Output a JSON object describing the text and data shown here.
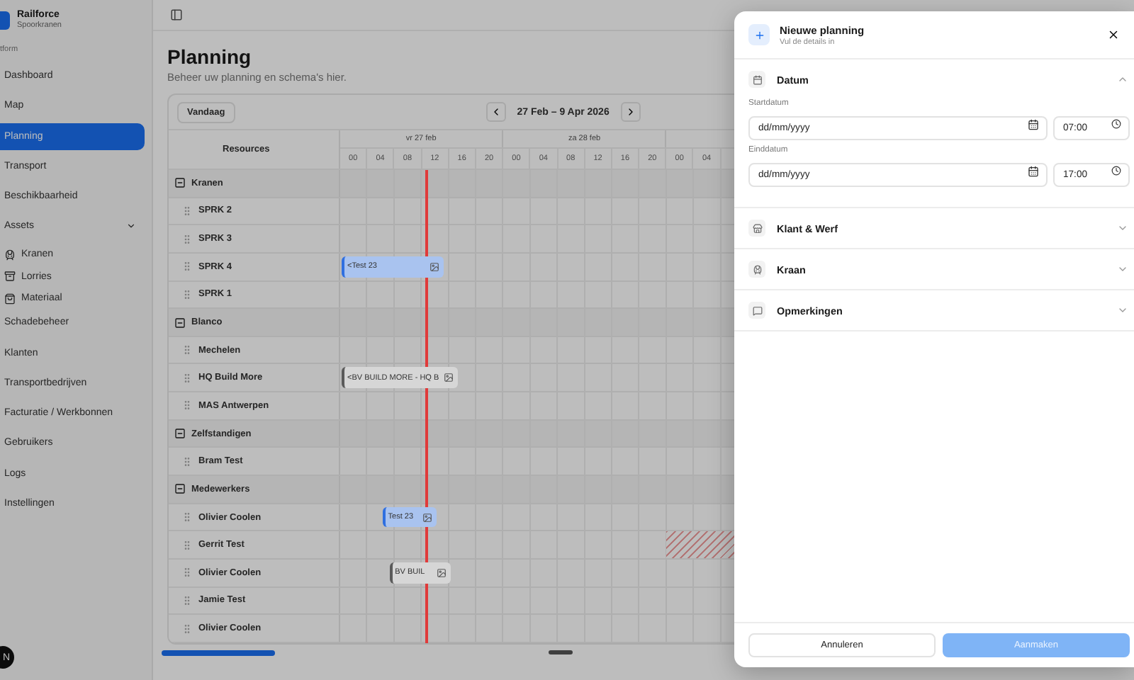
{
  "sidebar": {
    "brand": {
      "name": "Railforce",
      "subtitle": "Spoorkranen"
    },
    "group_label": "tform",
    "items": [
      {
        "label": "Dashboard",
        "selected": false
      },
      {
        "label": "Map",
        "selected": false
      },
      {
        "label": "Planning",
        "selected": true
      },
      {
        "label": "Transport",
        "selected": false
      },
      {
        "label": "Beschikbaarheid",
        "selected": false
      },
      {
        "label": "Assets",
        "selected": false,
        "expanded": true,
        "children": [
          {
            "label": "Kranen",
            "selected": false
          },
          {
            "label": "Lorries",
            "selected": false
          },
          {
            "label": "Materiaal",
            "selected": false
          }
        ]
      },
      {
        "label": "Schadebeheer",
        "selected": false
      },
      {
        "label": "Klanten",
        "selected": false
      },
      {
        "label": "Transportbedrijven",
        "selected": false
      },
      {
        "label": "Facturatie / Werkbonnen",
        "selected": false
      },
      {
        "label": "Gebruikers",
        "selected": false
      },
      {
        "label": "Logs",
        "selected": false
      },
      {
        "label": "Instellingen",
        "selected": false
      }
    ],
    "avatar": {
      "initial": "N"
    }
  },
  "page": {
    "title": "Planning",
    "subtitle": "Beheer uw planning en schema's hier."
  },
  "planner": {
    "today_button": "Vandaag",
    "range": "27 Feb – 9 Apr 2026",
    "resources_header": "Resources",
    "days": [
      {
        "label": "vr 27 feb",
        "hours": [
          "00",
          "04",
          "08",
          "12",
          "16",
          "20"
        ]
      },
      {
        "label": "za 28 feb",
        "hours": [
          "00",
          "04",
          "08",
          "12",
          "16",
          "20"
        ]
      },
      {
        "hours": [
          "00",
          "04"
        ]
      }
    ],
    "rows": [
      {
        "kind": "group",
        "label": "Kranen",
        "expanded": true
      },
      {
        "kind": "resource",
        "label": "SPRK 2",
        "unavailable": false
      },
      {
        "kind": "resource",
        "label": "SPRK 3",
        "unavailable": false
      },
      {
        "kind": "resource",
        "label": "SPRK 4",
        "unavailable": false,
        "bookings": [
          {
            "label": "<Test 23",
            "kind": "accent"
          }
        ]
      },
      {
        "kind": "resource",
        "label": "SPRK 1",
        "unavailable": false
      },
      {
        "kind": "group",
        "label": "Blanco",
        "expanded": true
      },
      {
        "kind": "resource",
        "label": "Mechelen",
        "unavailable": false
      },
      {
        "kind": "resource",
        "label": "HQ Build More",
        "unavailable": false,
        "bookings": [
          {
            "label": "<BV BUILD MORE - HQ B",
            "kind": "neutral"
          }
        ]
      },
      {
        "kind": "resource",
        "label": "MAS Antwerpen",
        "unavailable": false
      },
      {
        "kind": "group",
        "label": "Zelfstandigen",
        "expanded": true
      },
      {
        "kind": "resource",
        "label": "Bram Test",
        "unavailable": false
      },
      {
        "kind": "group",
        "label": "Medewerkers",
        "expanded": true
      },
      {
        "kind": "resource",
        "label": "Olivier Coolen",
        "unavailable": false,
        "bookings": [
          {
            "label": "Test 23",
            "kind": "accent"
          }
        ]
      },
      {
        "kind": "resource",
        "label": "Gerrit Test",
        "unavailable": true
      },
      {
        "kind": "resource",
        "label": "Olivier Coolen",
        "unavailable": false,
        "bookings": [
          {
            "label": "BV BUIL",
            "kind": "neutral"
          }
        ]
      },
      {
        "kind": "resource",
        "label": "Jamie Test",
        "unavailable": false
      },
      {
        "kind": "resource",
        "label": "Olivier Coolen",
        "unavailable": false
      }
    ]
  },
  "dialog": {
    "title": "Nieuwe planning",
    "subtitle": "Vul de details in",
    "sections": [
      {
        "title": "Datum",
        "expanded": true,
        "fields": [
          {
            "label": "Startdatum",
            "date_placeholder": "dd/mm/yyyy",
            "time": "07:00"
          },
          {
            "label": "Einddatum",
            "date_placeholder": "dd/mm/yyyy",
            "time": "17:00"
          }
        ]
      },
      {
        "title": "Klant & Werf",
        "expanded": false
      },
      {
        "title": "Kraan",
        "expanded": false
      },
      {
        "title": "Opmerkingen",
        "expanded": false
      }
    ],
    "buttons": [
      {
        "label": "Annuleren",
        "kind": "secondary",
        "disabled": false
      },
      {
        "label": "Aanmaken",
        "kind": "primary",
        "disabled": true
      }
    ]
  }
}
